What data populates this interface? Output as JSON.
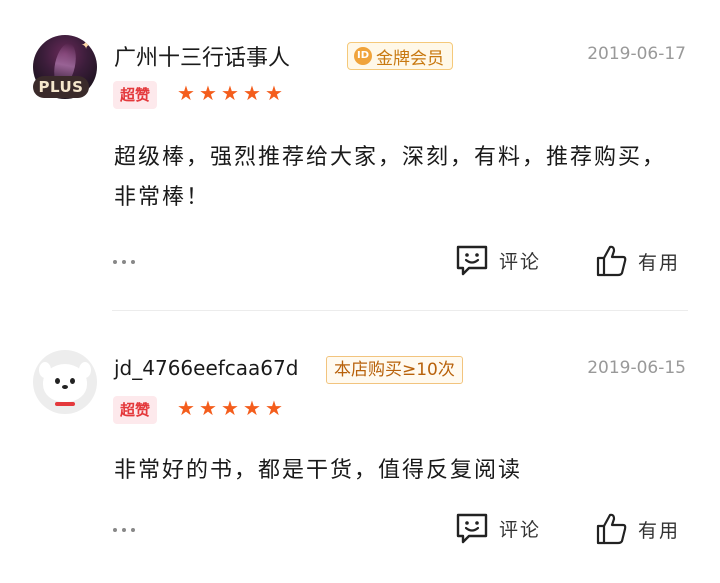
{
  "reviews": [
    {
      "username": "广州十三行话事人",
      "avatar_badge": "PLUS",
      "member_badge_icon": "ID",
      "member_badge": "金牌会员",
      "date": "2019-06-17",
      "praise_tag": "超赞",
      "rating": 5,
      "content": "超级棒，强烈推荐给大家，深刻，有料，推荐购买，非常棒！",
      "comment_label": "评论",
      "like_label": "有用"
    },
    {
      "username": "jd_4766eefcaa67d",
      "purchase_badge": "本店购买≥10次",
      "date": "2019-06-15",
      "praise_tag": "超赞",
      "rating": 5,
      "content": "非常好的书，都是干货，值得反复阅读",
      "comment_label": "评论",
      "like_label": "有用"
    }
  ],
  "colors": {
    "accent_red": "#e4393c",
    "star_orange": "#f45d1c",
    "gold": "#c8780f",
    "date_gray": "#999999"
  },
  "icons": {
    "more": "more-dots-icon",
    "comment": "comment-icon",
    "like": "thumbs-up-icon",
    "star": "star-icon"
  }
}
